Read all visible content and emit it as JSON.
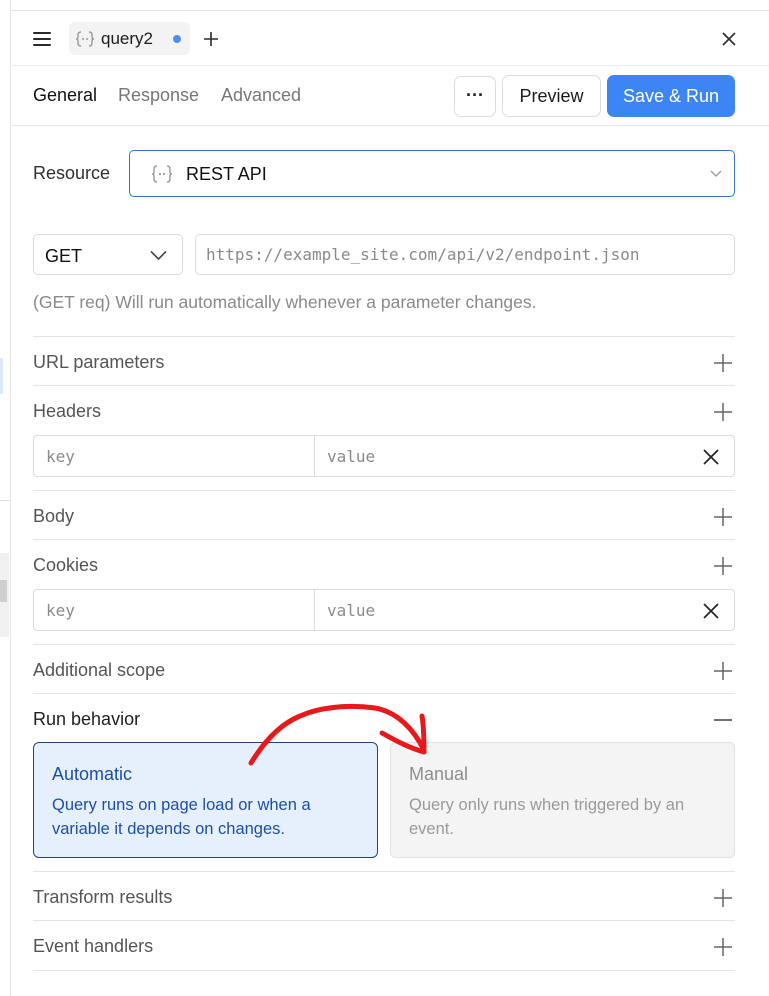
{
  "tab": {
    "name": "query2",
    "unsaved_dot_color": "#4a8ef5"
  },
  "subtabs": [
    "General",
    "Response",
    "Advanced"
  ],
  "toolbar": {
    "more_label": "···",
    "preview_label": "Preview",
    "save_run_label": "Save & Run",
    "accent": "#3d85f4"
  },
  "resource": {
    "label": "Resource",
    "value": "REST API"
  },
  "request": {
    "method": "GET",
    "url_placeholder": "https://example_site.com/api/v2/endpoint.json",
    "hint": "(GET req) Will run automatically whenever a parameter changes."
  },
  "sections": {
    "url_parameters": "URL parameters",
    "headers": "Headers",
    "body": "Body",
    "cookies": "Cookies",
    "additional_scope": "Additional scope",
    "run_behavior": "Run behavior",
    "transform_results": "Transform results",
    "event_handlers": "Event handlers"
  },
  "headers_row": {
    "key_placeholder": "key",
    "value_placeholder": "value"
  },
  "cookies_row": {
    "key_placeholder": "key",
    "value_placeholder": "value"
  },
  "run_behavior": {
    "automatic": {
      "title": "Automatic",
      "description": "Query runs on page load or when a variable it depends on changes.",
      "selected": true
    },
    "manual": {
      "title": "Manual",
      "description": "Query only runs when triggered by an event.",
      "selected": false
    }
  },
  "annotation": {
    "color": "#e8191b",
    "shape": "curved-arrow"
  }
}
